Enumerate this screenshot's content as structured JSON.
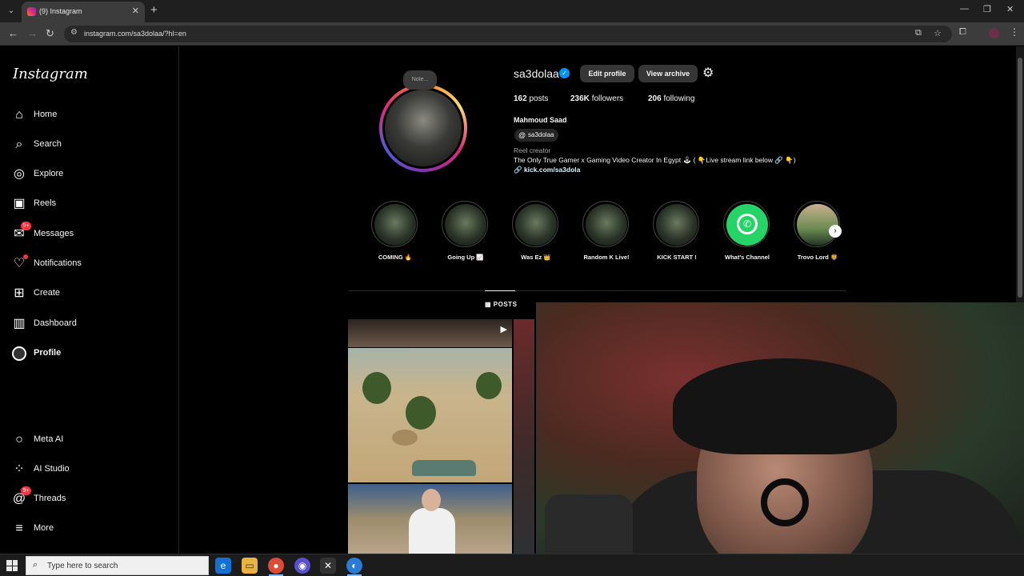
{
  "browser": {
    "tab_title": "(9) Instagram",
    "url": "instagram.com/sa3dolaa/?hl=en"
  },
  "sidebar": {
    "logo": "Instagram",
    "items": [
      {
        "label": "Home",
        "icon": "home-icon"
      },
      {
        "label": "Search",
        "icon": "search-icon"
      },
      {
        "label": "Explore",
        "icon": "compass-icon"
      },
      {
        "label": "Reels",
        "icon": "reels-icon"
      },
      {
        "label": "Messages",
        "icon": "messenger-icon",
        "badge": "9+"
      },
      {
        "label": "Notifications",
        "icon": "heart-icon"
      },
      {
        "label": "Create",
        "icon": "plus-square-icon"
      },
      {
        "label": "Dashboard",
        "icon": "dashboard-icon"
      },
      {
        "label": "Profile",
        "icon": "profile-avatar"
      }
    ],
    "bottom_items": [
      {
        "label": "Meta AI",
        "icon": "meta-ai-icon"
      },
      {
        "label": "AI Studio",
        "icon": "ai-studio-icon"
      },
      {
        "label": "Threads",
        "icon": "threads-icon",
        "badge": "9+"
      },
      {
        "label": "More",
        "icon": "menu-icon"
      }
    ]
  },
  "profile": {
    "note": "Note...",
    "username": "sa3dolaa",
    "edit_profile": "Edit profile",
    "view_archive": "View archive",
    "posts_count": "162",
    "posts_label": "posts",
    "followers_count": "236K",
    "followers_label": "followers",
    "following_count": "206",
    "following_label": "following",
    "full_name": "Mahmoud Saad",
    "threads_handle": "sa3dolaa",
    "category": "Reel creator",
    "bio": "The Only True Gamer x Gaming Video Creator In Egypt 🕹 ( 👇Live stream link below 🔗 👇)",
    "link": "kick.com/sa3dola"
  },
  "highlights": [
    {
      "label": "COMING 🔥"
    },
    {
      "label": "Going Up 📈"
    },
    {
      "label": "Was Ez 👑"
    },
    {
      "label": "Random K Live!"
    },
    {
      "label": "KICK START !"
    },
    {
      "label": "What's Channel"
    },
    {
      "label": "Trovo Lord 🦁"
    }
  ],
  "tabs": {
    "posts": "POSTS"
  },
  "taskbar": {
    "search_placeholder": "Type here to search"
  },
  "colors": {
    "accent": "#0095f6",
    "badge": "#ff3040",
    "whatsapp": "#25d366"
  }
}
